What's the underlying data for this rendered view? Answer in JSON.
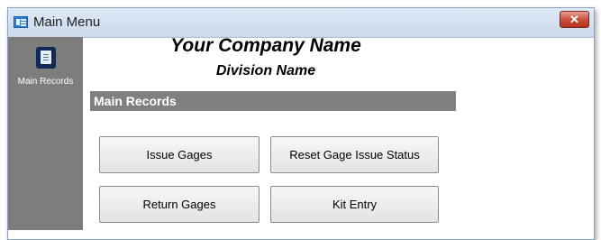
{
  "window": {
    "title": "Main Menu",
    "title_icon": "form-icon",
    "close_glyph": "✕"
  },
  "sidebar": {
    "items": [
      {
        "label": "Main Records",
        "icon": "records-icon"
      }
    ],
    "background": "#7d7d7d"
  },
  "header": {
    "company_name": "Your Company Name",
    "division_name": "Division Name"
  },
  "main": {
    "section_title": "Main Records",
    "buttons": [
      {
        "label": "Issue Gages"
      },
      {
        "label": "Reset Gage Issue Status"
      },
      {
        "label": "Return Gages"
      },
      {
        "label": "Kit Entry"
      }
    ]
  },
  "colors": {
    "section_header": "#808080",
    "close_button": "#c7513d",
    "titlebar": "#c9d9ec"
  }
}
